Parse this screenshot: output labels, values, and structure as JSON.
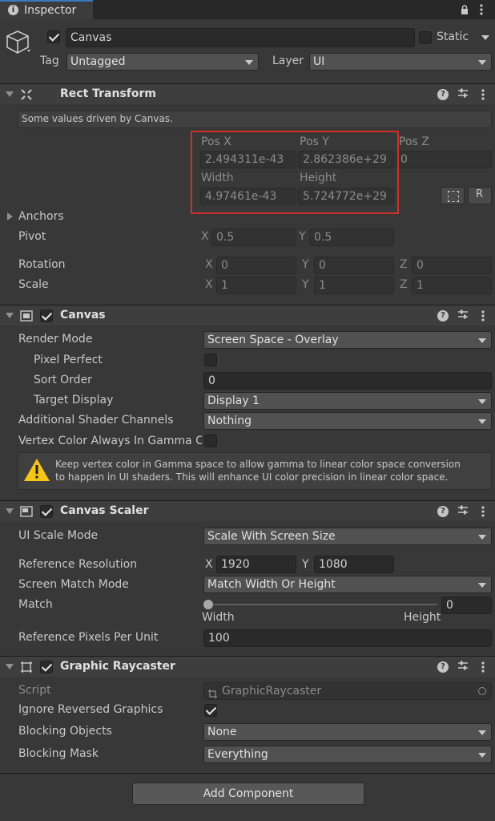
{
  "tab": {
    "title": "Inspector"
  },
  "object": {
    "name": "Canvas",
    "static_label": "Static",
    "tag_label": "Tag",
    "tag_value": "Untagged",
    "layer_label": "Layer",
    "layer_value": "UI"
  },
  "rect_transform": {
    "title": "Rect Transform",
    "driven_note": "Some values driven by Canvas.",
    "pos_x_label": "Pos X",
    "pos_x": "2.494311e-43",
    "pos_y_label": "Pos Y",
    "pos_y": "2.862386e+29",
    "pos_z_label": "Pos Z",
    "pos_z": "0",
    "width_label": "Width",
    "width": "4.97461e-43",
    "height_label": "Height",
    "height": "5.724772e+29",
    "r_button": "R",
    "anchors_label": "Anchors",
    "pivot_label": "Pivot",
    "pivot_x_label": "X",
    "pivot_x": "0.5",
    "pivot_y_label": "Y",
    "pivot_y": "0.5",
    "rotation_label": "Rotation",
    "rot_x": "0",
    "rot_y": "0",
    "rot_z": "0",
    "scale_label": "Scale",
    "scale_x": "1",
    "scale_y": "1",
    "scale_z": "1",
    "axis_x": "X",
    "axis_y": "Y",
    "axis_z": "Z"
  },
  "canvas": {
    "title": "Canvas",
    "render_mode_label": "Render Mode",
    "render_mode": "Screen Space - Overlay",
    "pixel_perfect_label": "Pixel Perfect",
    "sort_order_label": "Sort Order",
    "sort_order": "0",
    "target_display_label": "Target Display",
    "target_display": "Display 1",
    "shader_channels_label": "Additional Shader Channels",
    "shader_channels": "Nothing",
    "vertex_color_label": "Vertex Color Always In Gamma C",
    "warning_line1": "Keep vertex color in Gamma space to allow gamma to linear color space conversion",
    "warning_line2": "to happen in UI shaders. This will enhance UI color precision in linear color space."
  },
  "canvas_scaler": {
    "title": "Canvas Scaler",
    "ui_scale_mode_label": "UI Scale Mode",
    "ui_scale_mode": "Scale With Screen Size",
    "ref_res_label": "Reference Resolution",
    "ref_x_label": "X",
    "ref_x": "1920",
    "ref_y_label": "Y",
    "ref_y": "1080",
    "match_mode_label": "Screen Match Mode",
    "match_mode": "Match Width Or Height",
    "match_label": "Match",
    "match_value": "0",
    "match_slider_fraction": 0,
    "match_left": "Width",
    "match_right": "Height",
    "ppu_label": "Reference Pixels Per Unit",
    "ppu": "100"
  },
  "graphic_raycaster": {
    "title": "Graphic Raycaster",
    "script_label": "Script",
    "script_value": "GraphicRaycaster",
    "ignore_reversed_label": "Ignore Reversed Graphics",
    "blocking_objects_label": "Blocking Objects",
    "blocking_objects": "None",
    "blocking_mask_label": "Blocking Mask",
    "blocking_mask": "Everything"
  },
  "add_component": "Add Component",
  "colors": {
    "highlight": "#d0302a",
    "tab_accent": "#3a79bb",
    "warning": "#f5c518"
  }
}
